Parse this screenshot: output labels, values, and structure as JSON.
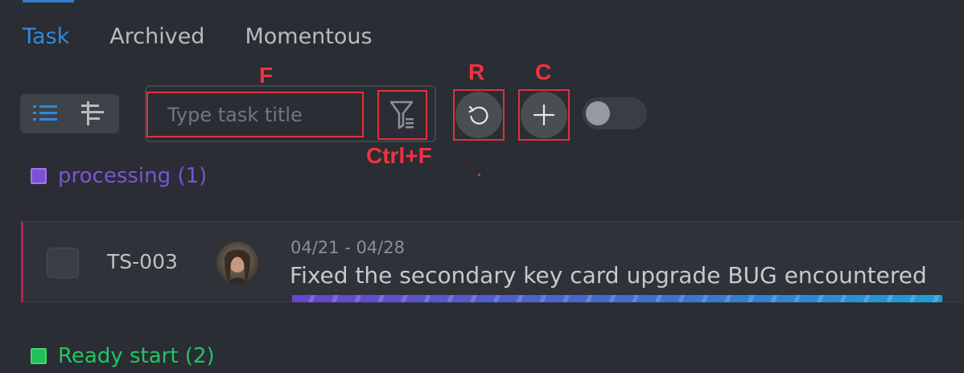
{
  "tabs": [
    {
      "label": "Task",
      "active": true
    },
    {
      "label": "Archived",
      "active": false
    },
    {
      "label": "Momentous",
      "active": false
    }
  ],
  "toolbar": {
    "view_modes": [
      "list-icon",
      "tree-icon"
    ],
    "search": {
      "placeholder": "Type task title",
      "value": ""
    },
    "filter_icon": "filter-icon",
    "refresh_icon": "refresh-icon",
    "create_icon": "plus-icon",
    "toggle_on": false
  },
  "hotkeys": {
    "search": "F",
    "filter": "Ctrl+F",
    "refresh": "R",
    "create": "C"
  },
  "groups": [
    {
      "label": "processing (1)",
      "color": "#7c50d0"
    },
    {
      "label": "Ready start (2)",
      "color": "#1fbf5a"
    }
  ],
  "task": {
    "id": "TS-003",
    "date_range": "04/21 - 04/28",
    "title": "Fixed the secondary key card upgrade BUG encountered",
    "accent_color": "#b0265a"
  },
  "colors": {
    "accent": "#2f8ae0",
    "hotkey": "#ef3341",
    "background": "#2a2d33"
  }
}
